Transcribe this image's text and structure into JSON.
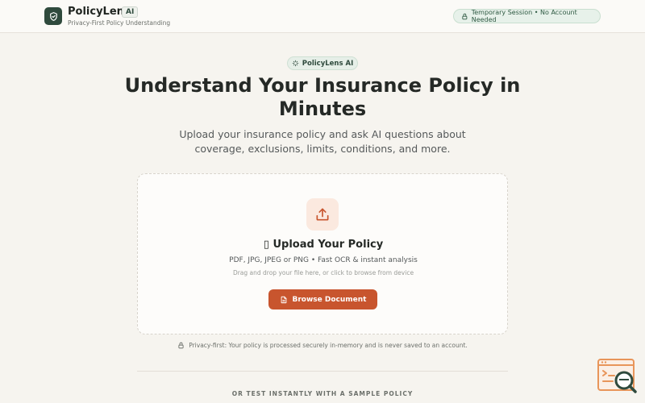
{
  "header": {
    "brand_name": "PolicyLens",
    "brand_badge": "AI",
    "tagline": "Privacy-First Policy Understanding",
    "session_status": "Temporary Session • No Account Needed"
  },
  "hero": {
    "badge_label": "PolicyLens AI",
    "title": "Understand Your Insurance Policy in Minutes",
    "subtitle": "Upload your insurance policy and ask AI questions about coverage, exclusions, limits, conditions, and more."
  },
  "upload": {
    "title": "▯ Upload Your Policy",
    "formats": "PDF, JPG, JPEG or PNG • Fast OCR & instant analysis",
    "hint": "Drag and drop your file here, or click to browse from device",
    "browse_label": "Browse Document"
  },
  "privacy_note": "Privacy-first: Your policy is processed securely in-memory and is never saved to an account.",
  "sample_section_label": "OR TEST INSTANTLY WITH A SAMPLE POLICY",
  "icons": {
    "logo": "shield-icon",
    "session": "lock-icon",
    "badge": "sparkle-icon",
    "upload": "upload-icon",
    "browse": "document-icon",
    "privacy": "lock-icon",
    "help": "search-chat-icon"
  },
  "colors": {
    "brand_dark": "#2f4a3d",
    "accent": "#c8552e",
    "background": "#f6f4ef"
  }
}
